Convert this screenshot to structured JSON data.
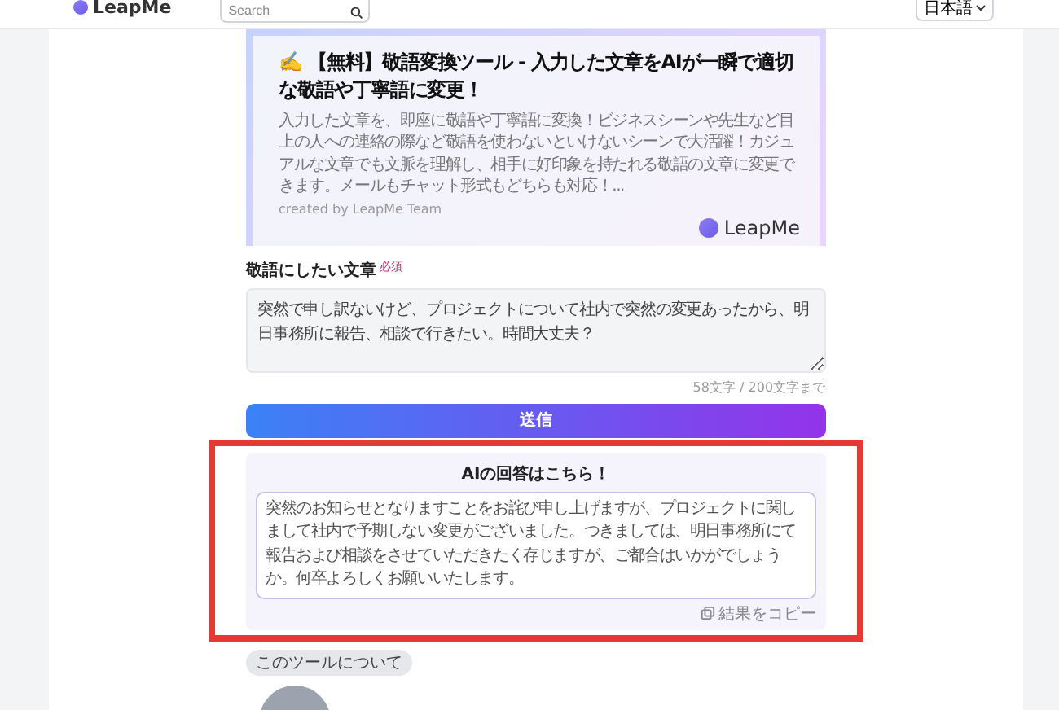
{
  "header": {
    "logo": "LeapMe",
    "search": {
      "placeholder": "Search"
    },
    "language": "日本語"
  },
  "hero": {
    "emoji": "✍️",
    "title": "【無料】敬語変換ツール - 入力した文章をAIが一瞬で適切な敬語や丁寧語に変更！",
    "description": "入力した文章を、即座に敬語や丁寧語に変換！ビジネスシーンや先生など目上の人への連絡の際など敬語を使わないといけないシーンで大活躍！カジュアルな文章でも文脈を理解し、相手に好印象を持たれる敬語の文章に変更できます。メールもチャット形式もどちらも対応！...",
    "author": "created by LeapMe Team",
    "brand": "LeapMe"
  },
  "form": {
    "label": "敬語にしたい文章",
    "required": "必須",
    "value": "突然で申し訳ないけど、プロジェクトについて社内で突然の変更あったから、明日事務所に報告、相談で行きたい。時間大丈夫？",
    "counter": "58文字 / 200文字まで",
    "submit": "送信"
  },
  "result": {
    "highlighted": true,
    "title": "AIの回答はこちら！",
    "text": "突然のお知らせとなりますことをお詫び申し上げますが、プロジェクトに関しまして社内で予期しない変更がございました。つきましては、明日事務所にて報告および相談をさせていただきたく存じますが、ご都合はいかがでしょうか。何卒よろしくお願いいたします。",
    "copy": "結果をコピー"
  },
  "about": {
    "tag": "このツールについて"
  }
}
